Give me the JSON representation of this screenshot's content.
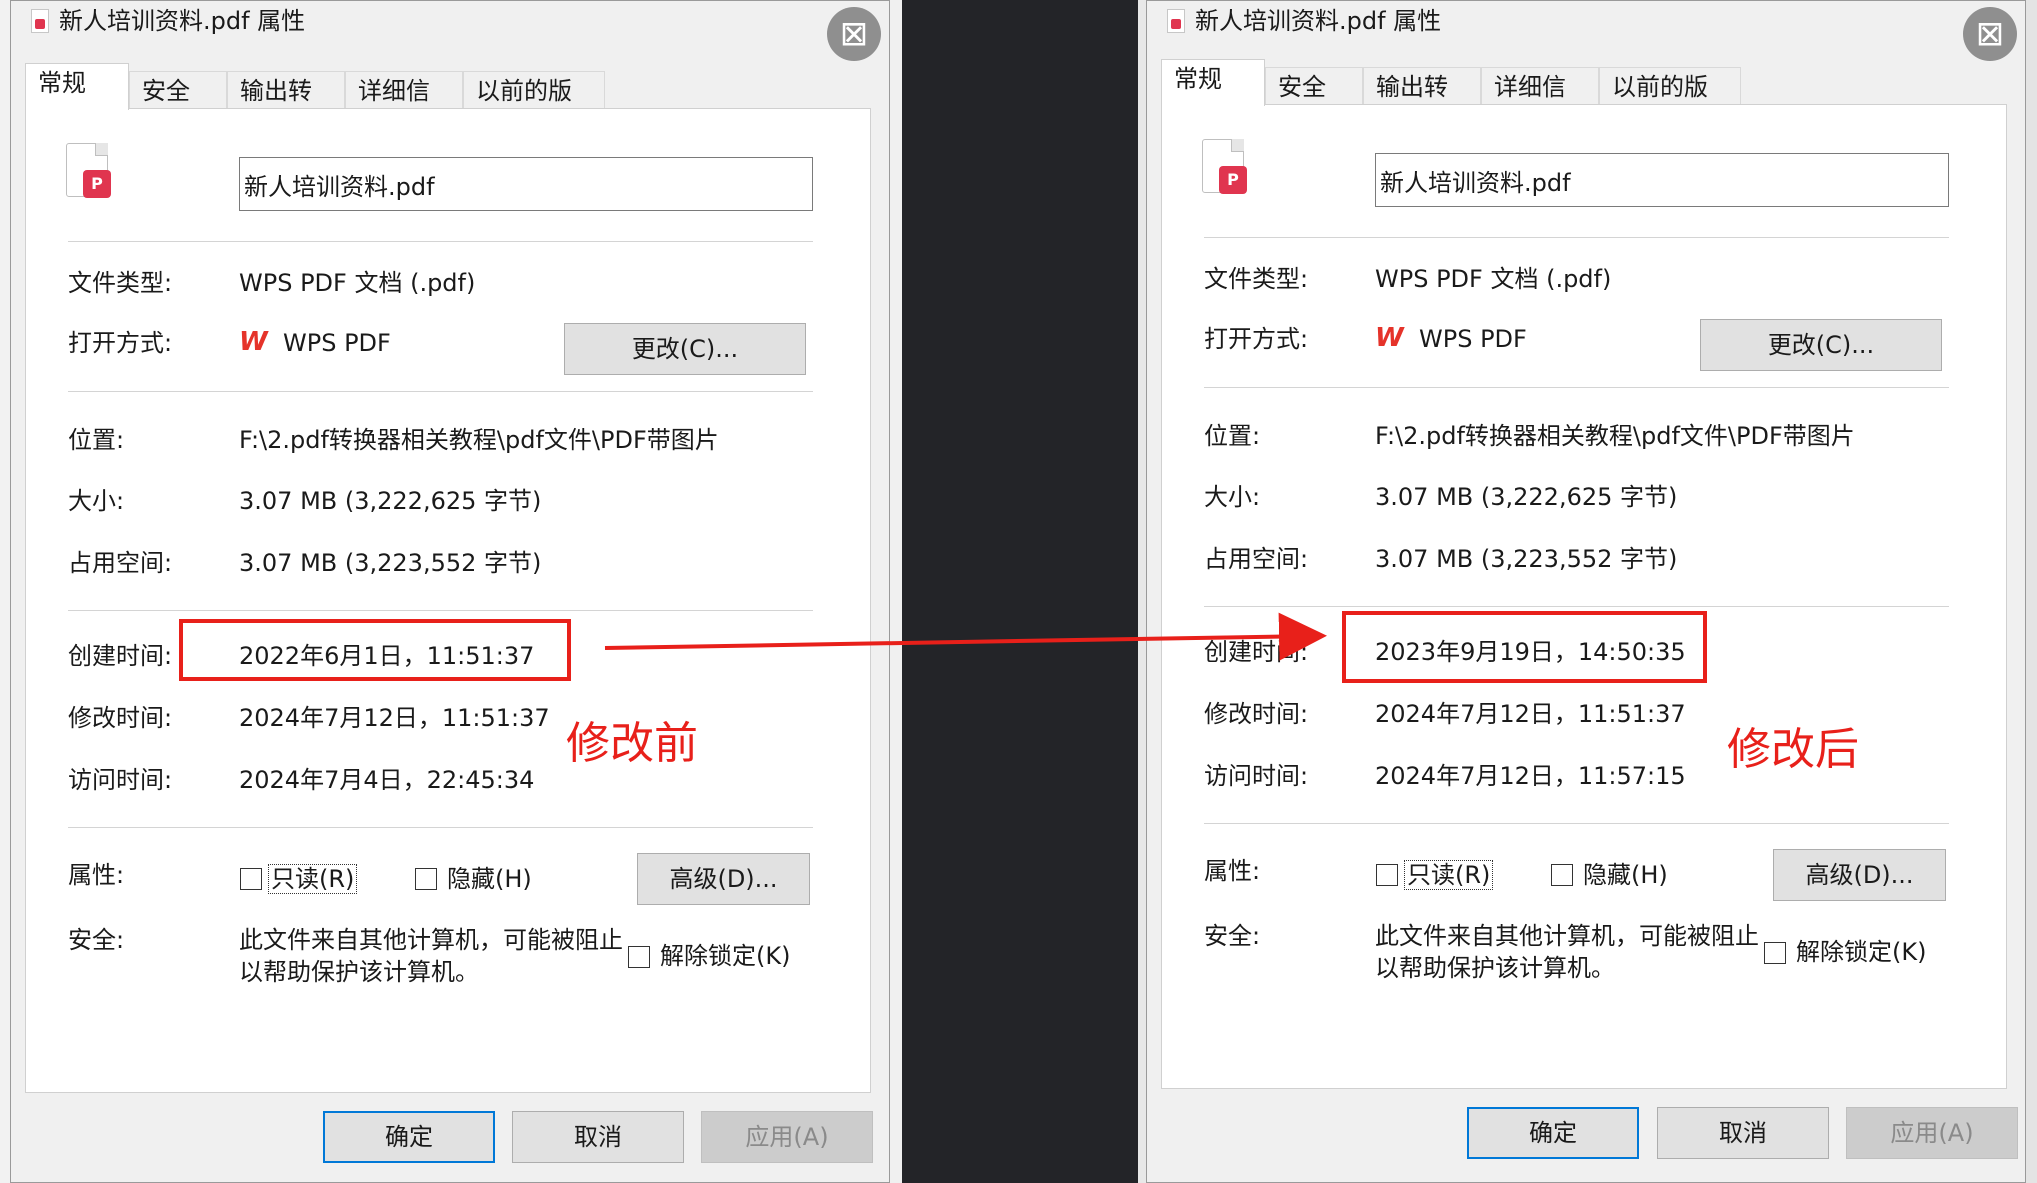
{
  "left": {
    "title": "新人培训资料.pdf 属性",
    "tabs": [
      "常规",
      "安全",
      "输出转换",
      "详细信息",
      "以前的版本"
    ],
    "filename": "新人培训资料.pdf",
    "rows": {
      "type_label": "文件类型:",
      "type_value": "WPS PDF 文档 (.pdf)",
      "open_label": "打开方式:",
      "open_value": "WPS PDF",
      "change_button": "更改(C)...",
      "location_label": "位置:",
      "location_value": "F:\\2.pdf转换器相关教程\\pdf文件\\PDF带图片",
      "size_label": "大小:",
      "size_value": "3.07 MB (3,222,625 字节)",
      "disk_label": "占用空间:",
      "disk_value": "3.07 MB (3,223,552 字节)",
      "created_label": "创建时间:",
      "created_value": "2022年6月1日，11:51:37",
      "modified_label": "修改时间:",
      "modified_value": "2024年7月12日，11:51:37",
      "accessed_label": "访问时间:",
      "accessed_value": "2024年7月4日，22:45:34",
      "attr_label": "属性:",
      "readonly_label": "只读(R)",
      "hidden_label": "隐藏(H)",
      "advanced_button": "高级(D)...",
      "security_label": "安全:",
      "security_text": "此文件来自其他计算机，可能被阻止以帮助保护该计算机。",
      "unblock_label": "解除锁定(K)"
    },
    "buttons": {
      "ok": "确定",
      "cancel": "取消",
      "apply": "应用(A)"
    },
    "annotation": "修改前"
  },
  "right": {
    "title": "新人培训资料.pdf 属性",
    "tabs": [
      "常规",
      "安全",
      "输出转换",
      "详细信息",
      "以前的版本"
    ],
    "filename": "新人培训资料.pdf",
    "rows": {
      "type_label": "文件类型:",
      "type_value": "WPS PDF 文档 (.pdf)",
      "open_label": "打开方式:",
      "open_value": "WPS PDF",
      "change_button": "更改(C)...",
      "location_label": "位置:",
      "location_value": "F:\\2.pdf转换器相关教程\\pdf文件\\PDF带图片",
      "size_label": "大小:",
      "size_value": "3.07 MB (3,222,625 字节)",
      "disk_label": "占用空间:",
      "disk_value": "3.07 MB (3,223,552 字节)",
      "created_label": "创建时间:",
      "created_value": "2023年9月19日，14:50:35",
      "modified_label": "修改时间:",
      "modified_value": "2024年7月12日，11:51:37",
      "accessed_label": "访问时间:",
      "accessed_value": "2024年7月12日，11:57:15",
      "attr_label": "属性:",
      "readonly_label": "只读(R)",
      "hidden_label": "隐藏(H)",
      "advanced_button": "高级(D)...",
      "security_label": "安全:",
      "security_text": "此文件来自其他计算机，可能被阻止以帮助保护该计算机。",
      "unblock_label": "解除锁定(K)"
    },
    "buttons": {
      "ok": "确定",
      "cancel": "取消",
      "apply": "应用(A)"
    },
    "annotation": "修改后"
  },
  "colors": {
    "annotation_red": "#e8201a",
    "pdf_badge": "#e0354f",
    "focus_blue": "#0078d7"
  },
  "icons": {
    "overlay_button": "translate-icon",
    "file": "pdf-file-icon",
    "app": "wps-logo-icon"
  }
}
